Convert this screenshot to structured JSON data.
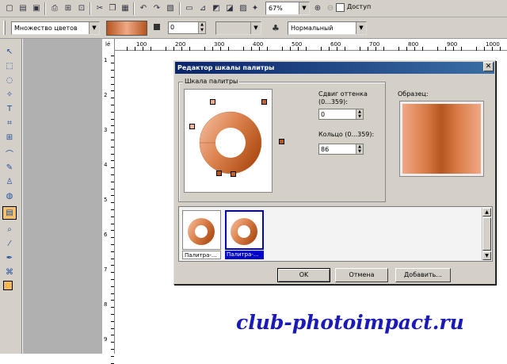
{
  "toolbar": {
    "zoom_value": "67%",
    "access_label": "Доступ"
  },
  "attrbar": {
    "fill_mode": "Множество цветов",
    "value_field": "0",
    "blend_mode": "Нормальный"
  },
  "ruler": {
    "top_prefix": "lé",
    "top_marks": [
      "100",
      "200",
      "300",
      "400",
      "500",
      "600",
      "700",
      "800",
      "900",
      "1000"
    ],
    "left_marks": [
      "1",
      "2",
      "3",
      "4",
      "5",
      "6",
      "7",
      "8",
      "9"
    ]
  },
  "dialog": {
    "title": "Редактор шкалы палитры",
    "close": "✕",
    "group_label": "Шкала палитры",
    "hue_shift_label": "Сдвиг оттенка (0...359):",
    "hue_shift_value": "0",
    "ring_label": "Кольцо (0...359):",
    "ring_value": "86",
    "sample_label": "Образец:",
    "thumbnails": [
      {
        "label": "Палитра-..."
      },
      {
        "label": "Палитра-..."
      }
    ],
    "ok": "OK",
    "cancel": "Отмена",
    "add": "Добавить..."
  },
  "colors": {
    "accent_dark": "#b5551f",
    "accent_light": "#f0a885",
    "title_bar": "#0a246a",
    "selection": "#0000c8"
  },
  "watermark": "club-photoimpact.ru"
}
